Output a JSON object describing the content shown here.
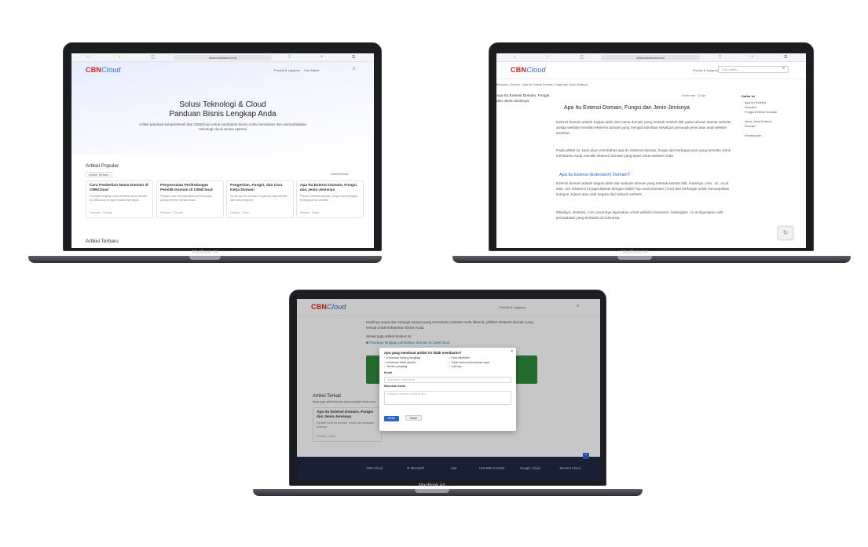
{
  "laptop_label": "MacBook Air",
  "brand": {
    "cbn": "CBN",
    "cloud": "Cloud"
  },
  "screen1": {
    "url": "www.cbncloud.co.id",
    "nav": [
      "Produk & Layanan",
      "Cari Artikel"
    ],
    "hero_title_1": "Solusi Teknologi & Cloud",
    "hero_title_2": "Panduan Bisnis Lengkap Anda",
    "hero_sub": "Artikel panduan komprehensif dari CBNCloud untuk membantu bisnis Anda memahami dan memanfaatkan teknologi cloud secara optimal",
    "popular_title": "Artikel Populer",
    "filter_label": "Lihat Semua",
    "popular_tab": "Artikel Terbaru",
    "cards": [
      {
        "title": "Cara Pembelian Nama Domain di CBNCloud",
        "excerpt": "Panduan lengkap cara membeli nama domain di CBNCloud dengan mudah dan cepat.",
        "meta": "Panduan · Domain"
      },
      {
        "title": "Penyesuaian Perlindungan Pemilik Domain di CBNCloud",
        "excerpt": "Pelajari cara menyesuaikan perlindungan privasi pemilik domain Anda.",
        "meta": "Panduan · Domain"
      },
      {
        "title": "Pengertian, Fungsi, dan Cara Kerja Domain",
        "excerpt": "Kenali apa itu domain, fungsinya bagi website dan cara kerjanya.",
        "meta": "Domain · Dasar"
      },
      {
        "title": "Apa Itu Extensi Domain, Fungsi dan Jenis-Jenisnya",
        "excerpt": "Pahami ekstensi domain, fungsi dan berbagai jenisnya untuk website.",
        "meta": "Domain · Dasar"
      }
    ],
    "latest_title": "Artikel Terbaru"
  },
  "screen2": {
    "url": "www.cbncloud.co.id",
    "nav": "Produk & Layanan",
    "search_placeholder": "Cari artikel...",
    "breadcrumb": "Beranda > Domain > Apa Itu Extensi Domain, Fungsi dan Jenis-Jenisnya",
    "sidebar_title": "Apa Itu Extensi Domain, Fungsi dan Jenis-Jenisnya",
    "meta": "8 min read · 12 Apr",
    "title": "Apa Itu Extensi Domain, Fungsi dan Jenis-Jenisnya",
    "para1": "Extensi domain adalah bagian akhir dari nama domain yang terletak setelah titik pada sebuah alamat website. Setiap website memiliki ekstensi domain yang menjadi identitas sekaligus penunjuk jenis atau asal website tersebut.",
    "para2": "Pada artikel ini, kami akan membahas apa itu ekstensi domain, fungsi dan berbagai jenis yang tersedia untuk membantu Anda memilih ekstensi domain yang tepat untuk website Anda.",
    "h2": "Apa Itu Extensi (Extension) Domain?",
    "para3": "Extensi domain adalah bagian akhir dari sebuah domain yang terletak setelah titik, misalnya .com, .id, .co.id atau .net. Ekstensi ini juga dikenal dengan istilah Top Level Domain (TLD) dan berfungsi untuk menunjukkan kategori, tujuan atau asal negara dari sebuah website.",
    "para4": "Misalnya, ekstensi .com umumnya digunakan untuk website komersial, sedangkan .co.id digunakan oleh perusahaan yang berbasis di Indonesia.",
    "toc_title": "Daftar Isi",
    "toc": [
      "Apa Itu Extensi Domain?",
      "Fungsi Extensi Domain",
      "Jenis-Jenis Extensi Domain",
      "Kesimpulan"
    ]
  },
  "screen3": {
    "nav": "Produk & Layanan",
    "body1": "Hasilnya cepat dan sebagai sarana yang membantu website Anda dikenal, pilihlah ekstensi domain yang sesuai untuk kebutuhan bisnis Anda.",
    "body2": "Simak juga artikel berikut ini:",
    "bullet": "Panduan lengkap pembelian domain di CBNCloud",
    "related_title": "Artikel Terkait",
    "related_sub": "Baca juga artikel lainnya yang mungkin Anda suka",
    "related_card_title": "Apa Itu Extensi Domain, Fungsi dan Jenis-Jenisnya",
    "related_card_excerpt": "Pahami ekstensi domain, fungsi dan berbagai jenisnya.",
    "related_card_meta": "Domain · Dasar",
    "modal": {
      "title": "Apa yang membuat artikel ini tidak membantu?",
      "options": [
        "Informasi kurang lengkap",
        "Sulit dipahami",
        "Informasi tidak akurat",
        "Tidak sesuai kebutuhan saya",
        "Terlalu panjang",
        "Lainnya"
      ],
      "email_label": "Email",
      "email_placeholder": "Masukkan email Anda",
      "feedback_label": "Masukan Anda",
      "feedback_placeholder": "Tuliskan masukan Anda di sini...",
      "submit": "Kirim",
      "cancel": "Batal"
    },
    "partners": [
      "CBN Cloud",
      "Microsoft",
      "aws",
      "HUAWEI CLOUD",
      "Google Cloud",
      "Tencent Cloud"
    ]
  }
}
